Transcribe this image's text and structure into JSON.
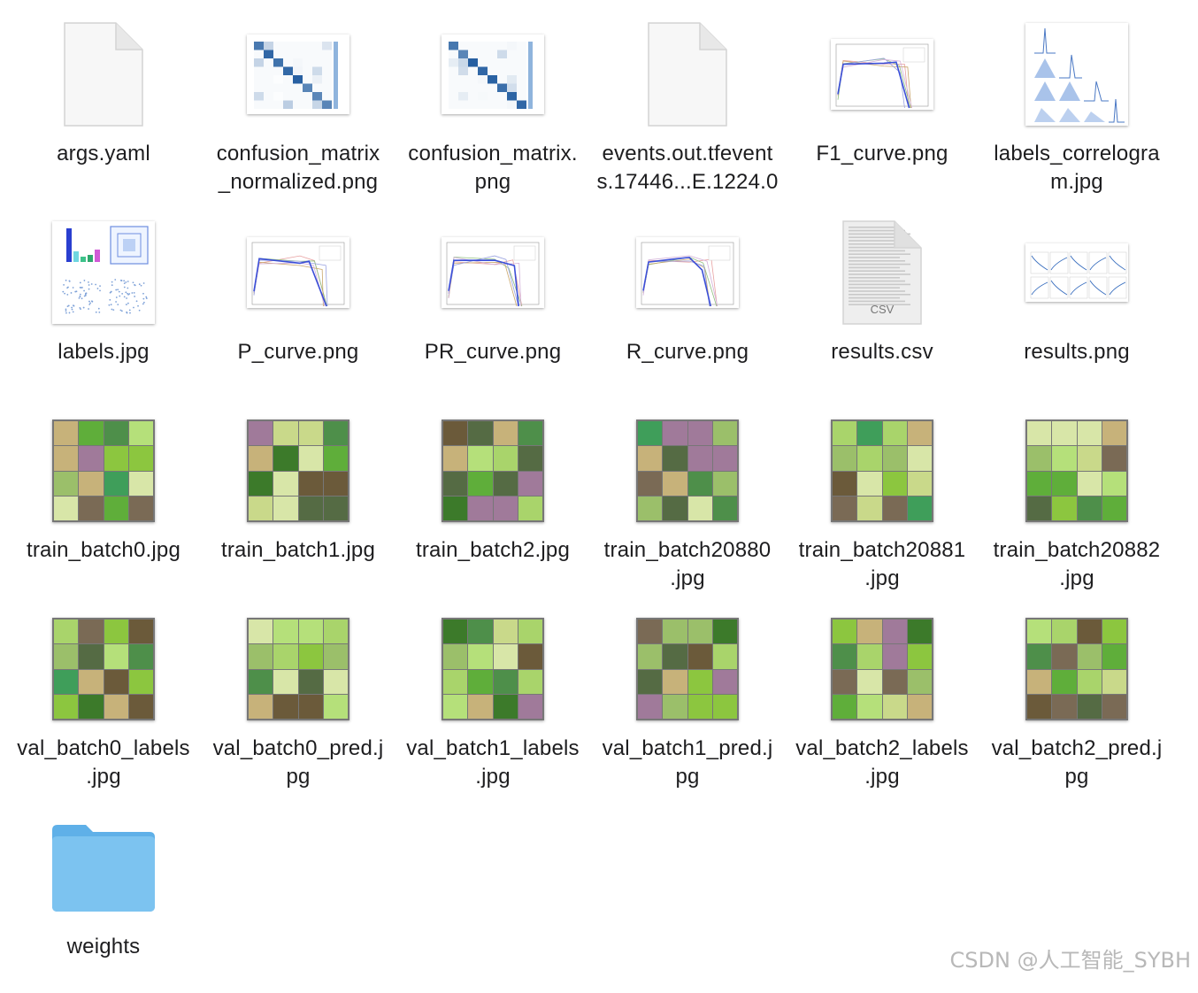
{
  "files": [
    {
      "name": "args.yaml",
      "kind": "doc"
    },
    {
      "name": "confusion_matrix\n_normalized.png",
      "kind": "matrix"
    },
    {
      "name": "confusion_matrix.\npng",
      "kind": "matrix"
    },
    {
      "name": "events.out.tfevent\ns.17446...E.1224.0",
      "kind": "doc"
    },
    {
      "name": "F1_curve.png",
      "kind": "curve"
    },
    {
      "name": "labels_correlogra\nm.jpg",
      "kind": "correlogram"
    },
    {
      "name": "labels.jpg",
      "kind": "labels"
    },
    {
      "name": "P_curve.png",
      "kind": "curve"
    },
    {
      "name": "PR_curve.png",
      "kind": "curve"
    },
    {
      "name": "R_curve.png",
      "kind": "curve"
    },
    {
      "name": "results.csv",
      "kind": "csv",
      "badge": "CSV"
    },
    {
      "name": "results.png",
      "kind": "results"
    },
    {
      "name": "train_batch0.jpg",
      "kind": "batch"
    },
    {
      "name": "train_batch1.jpg",
      "kind": "batch"
    },
    {
      "name": "train_batch2.jpg",
      "kind": "batch"
    },
    {
      "name": "train_batch20880\n.jpg",
      "kind": "batch"
    },
    {
      "name": "train_batch20881\n.jpg",
      "kind": "batch"
    },
    {
      "name": "train_batch20882\n.jpg",
      "kind": "batch"
    },
    {
      "name": "val_batch0_labels\n.jpg",
      "kind": "batch"
    },
    {
      "name": "val_batch0_pred.j\npg",
      "kind": "batch"
    },
    {
      "name": "val_batch1_labels\n.jpg",
      "kind": "batch"
    },
    {
      "name": "val_batch1_pred.j\npg",
      "kind": "batch"
    },
    {
      "name": "val_batch2_labels\n.jpg",
      "kind": "batch"
    },
    {
      "name": "val_batch2_pred.j\npg",
      "kind": "batch"
    },
    {
      "name": "weights",
      "kind": "folder"
    }
  ],
  "watermark": "CSDN @人工智能_SYBH",
  "colors": {
    "folder": "#7cc3f0",
    "folder_tab": "#5fb0e8",
    "matrix": "#1f5a9e",
    "curve": "#3b4fd8"
  }
}
